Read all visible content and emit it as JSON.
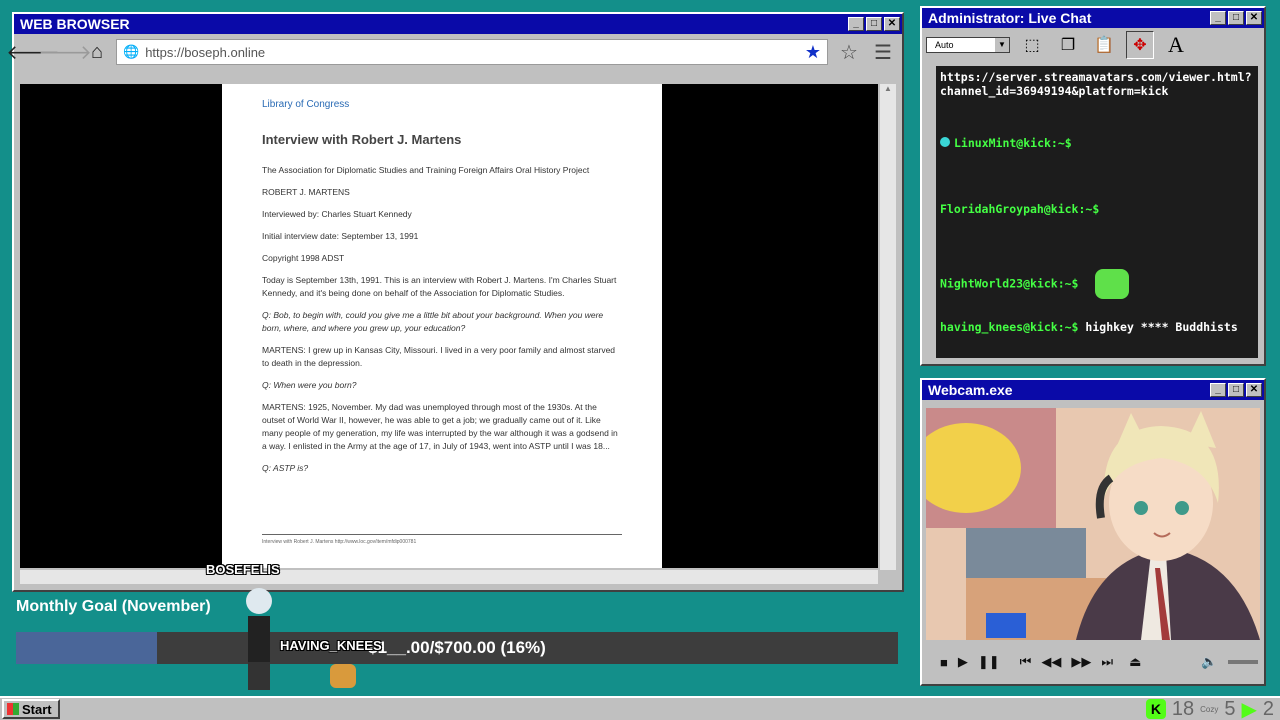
{
  "browser": {
    "title": "WEB BROWSER",
    "url": "https://boseph.online",
    "document": {
      "source": "Library of Congress",
      "title": "Interview with Robert J. Martens",
      "project": "The Association for Diplomatic Studies and Training Foreign Affairs Oral History Project",
      "name": "ROBERT J. MARTENS",
      "interviewer": "Interviewed by: Charles Stuart Kennedy",
      "date": "Initial interview date: September 13, 1991",
      "copyright": "Copyright 1998 ADST",
      "intro": "Today is September 13th, 1991. This is an interview with Robert J. Martens. I'm Charles Stuart Kennedy, and it's being done on behalf of the Association for Diplomatic Studies.",
      "q1": "Q: Bob, to begin with, could you give me a little bit about your background. When you were born, where, and where you grew up, your education?",
      "a1": "MARTENS: I grew up in Kansas City, Missouri. I lived in a very poor family and almost starved to death in the depression.",
      "q2": "Q: When were you born?",
      "a2": "MARTENS: 1925, November. My dad was unemployed through most of the 1930s. At the outset of World War II, however, he was able to get a job; we gradually came out of it. Like many people of my generation, my life was interrupted by the war although it was a godsend in a way. I enlisted in the Army at the age of 17, in July of 1943, went into ASTP until I was 18...",
      "q3": "Q: ASTP is?",
      "footer": "Interview with Robert J. Martens http://www.loc.gov/item/mfdip000781"
    }
  },
  "chat": {
    "title": "Administrator: Live Chat",
    "font_combo": "Auto",
    "link": "https://server.streamavatars.com/viewer.html?channel_id=36949194&platform=kick",
    "messages": [
      {
        "user": "LinuxMint@kick:~$",
        "text": ""
      },
      {
        "user": "FloridahGroypah@kick:~$",
        "text": ""
      },
      {
        "user": "NightWorld23@kick:~$",
        "text": ""
      },
      {
        "user": "having_knees@kick:~$",
        "text": "highkey **** Buddhists"
      }
    ]
  },
  "webcam": {
    "title": "Webcam.exe"
  },
  "goal": {
    "label": "Monthly Goal (November)",
    "progress_text": "$1__.00/$700.00 (16%)",
    "percent": 16
  },
  "overlay": {
    "name1": "BOSEFELIS",
    "name2": "HAVING_KNEES"
  },
  "taskbar": {
    "start": "Start",
    "tray_count1": "18",
    "tray_label": "Cozy",
    "tray_count2": "5",
    "tray_count3": "2"
  }
}
